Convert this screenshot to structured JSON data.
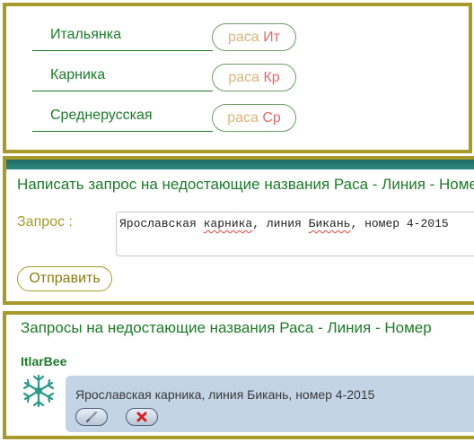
{
  "breeds": [
    {
      "name": "Итальянка",
      "word": "раса",
      "code": "Ит"
    },
    {
      "name": "Карника",
      "word": "раса",
      "code": "Кр"
    },
    {
      "name": "Среднерусская",
      "word": "раса",
      "code": "Ср"
    }
  ],
  "form": {
    "title": "Написать запрос на недостающие названия Раса - Линия - Номер",
    "label": "Запрос :",
    "text_parts": [
      "Ярославская ",
      "карника",
      ", линия ",
      "Бикань",
      ", номер 4-2015"
    ],
    "submit_label": "Отправить"
  },
  "requests": {
    "title": "Запросы на недостающие названия Раса - Линия - Номер",
    "items": [
      {
        "user": "ItlarBee",
        "text": "Ярославская карника, линия Бикань, номер 4-2015",
        "avatar_icon": "snowflake-avatar-icon"
      }
    ],
    "edit_icon": "pencil-icon",
    "delete_icon": "close-icon"
  },
  "colors": {
    "accent_olive": "#a89a2a",
    "text_green": "#1d7a2a",
    "card_blue": "#c2d4e6",
    "delete_red": "#d42020"
  }
}
